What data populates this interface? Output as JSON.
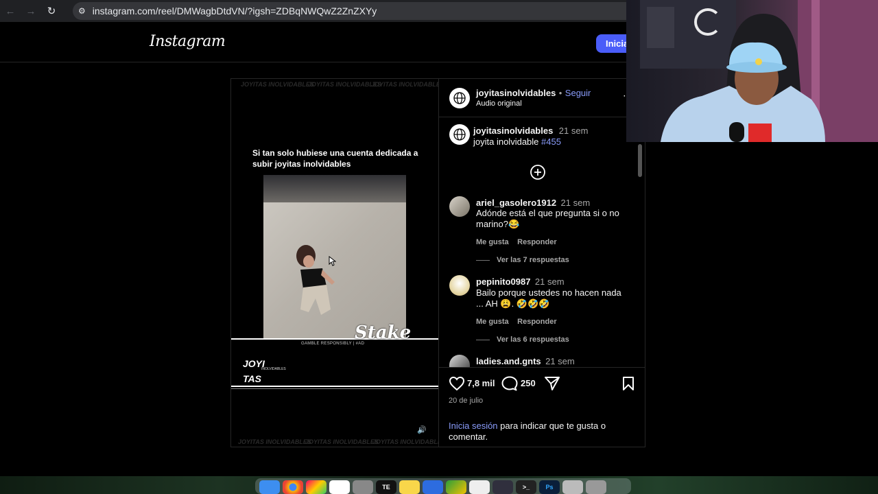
{
  "browser": {
    "url": "instagram.com/reel/DMWagbDtdVN/?igsh=ZDBqNWQwZ2ZnZXYy"
  },
  "header": {
    "logo": "Instagram",
    "login_button": "Inicia"
  },
  "video": {
    "watermark": "JOYITAS INOLVIDABLES",
    "caption": "Si tan solo hubiese una cuenta dedicada a subir joyitas inolvidables",
    "ad_logo": "Stake",
    "ad_disclaimer": "GAMBLE RESPONSIBLY | #AD",
    "brand_line1": "JOYI",
    "brand_line2": "TAS",
    "brand_sub": "INOLVIDABLES"
  },
  "post": {
    "author": "joyitasinolvidables",
    "separator": "•",
    "follow": "Seguir",
    "audio": "Audio original",
    "caption_author": "joyitasinolvidables",
    "caption_time": "21 sem",
    "caption_text": "joyita inolvidable",
    "caption_tag": "#455",
    "likes": "7,8 mil",
    "comments_count": "250",
    "date": "20 de julio",
    "login_link": "Inicia sesión",
    "login_prompt": " para indicar que te gusta o comentar."
  },
  "comments": [
    {
      "user": "ariel_gasolero1912",
      "time": "21 sem",
      "text": "Adónde está el que pregunta si o no marino?😂",
      "like": "Me gusta",
      "reply": "Responder",
      "view_replies": "Ver las 7 respuestas"
    },
    {
      "user": "pepinito0987",
      "time": "21 sem",
      "text": "Bailo porque ustedes no hacen nada ... AH 😩. 🤣🤣🤣",
      "like": "Me gusta",
      "reply": "Responder",
      "view_replies": "Ver las 6 respuestas"
    },
    {
      "user": "ladies.and.gnts",
      "time": "21 sem"
    }
  ],
  "dock": [
    "Finder",
    "Chrome",
    "Launchpad",
    "Reminders",
    "Settings",
    "TE",
    "Notes",
    "Roblox",
    "Hopper",
    "Notion",
    "OBS",
    "Terminal",
    "Ps",
    "Files",
    "Trash"
  ]
}
